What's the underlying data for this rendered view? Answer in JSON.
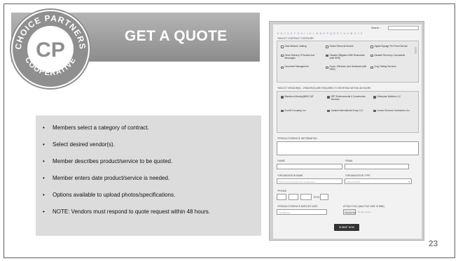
{
  "slide": {
    "title": "GET A QUOTE",
    "page_number": "23",
    "logo": {
      "text_top": "CHOICE PARTNERS",
      "monogram": "CP",
      "text_bottom": "COOPERATIVE"
    },
    "bullets": [
      "Members select a category of contract.",
      "Select desired vendor(s).",
      "Member describes product/service to be quoted.",
      "Member enters date product/service is needed.",
      "Options available to upload photos/specifications.",
      "NOTE: Vendors must respond to quote request within 48 hours."
    ]
  },
  "form": {
    "search_label": "Search :",
    "alphabet": [
      "A",
      "B",
      "C",
      "D",
      "E",
      "F",
      "G",
      "H",
      "I",
      "J",
      "K",
      "L",
      "M",
      "N",
      "O",
      "P",
      "Q",
      "R",
      "S",
      "T",
      "U",
      "V",
      "W",
      "X",
      "Y",
      "Z"
    ],
    "categories_label": "*SELECT CONTRACT CATEGORY",
    "categories": [
      {
        "label": "Data Network Cabling",
        "checked": false
      },
      {
        "label": "Debris Removal Service",
        "checked": false
      },
      {
        "label": "Digital Signage Per Fixed Service",
        "checked": false
      },
      {
        "label": "Direct Delivery Of Snacks And Beverages",
        "checked": false
      },
      {
        "label": "Disaster Mitigation With Restoration (with RMS)",
        "checked": true
      },
      {
        "label": "Disaster Recovery Consultants",
        "checked": false
      },
      {
        "label": "Document Management",
        "checked": false
      },
      {
        "label": "Doors, Windows, And Hardware (with RMS)",
        "checked": false
      },
      {
        "label": "Drug Testing Services",
        "checked": false
      }
    ],
    "vendors_label": "*SELECT VENDOR(S) - VENDOR(S) ARE REQUIRED TO RESPOND WITHIN 48 HOURS",
    "vendors": [
      {
        "label": "Blackmon Mooring/BMS CAT",
        "checked": true
      },
      {
        "label": "DRT Environmental & Construction Services",
        "checked": true
      },
      {
        "label": "Enterprise Builders LLC",
        "checked": true
      },
      {
        "label": "Ecoloft Company, Inc.",
        "checked": true
      },
      {
        "label": "Garland International Group LLC",
        "checked": true
      },
      {
        "label": "Lemon Services Contractors, Inc.",
        "checked": true
      }
    ],
    "description_label": "*PRODUCT/SERVICE INFORMATION",
    "name_label": "*NAME",
    "email_label": "*EMAIL",
    "organization_label": "*ORGANIZATION NAME",
    "organization_hint": "Harris County Department of Education",
    "org_type_label": "*ORGANIZATION TYPE",
    "org_type_value": "School District",
    "phone_label": "*PHONE",
    "ext_label": "EXT#",
    "date_label": "*PRODUCT/SERVICE NEED BY DATE",
    "date_value": "mm/dd/yyyy",
    "attach_label": "ATTACH FILE (MAX FILE SIZE IS 5MB)",
    "choose_file": "Choose File",
    "no_file": "No file chosen",
    "submit_label": "SUBMIT NOW"
  },
  "colors": {
    "header_band": "#a3a3a3",
    "bullet_box": "#dcdcdc",
    "logo": "#8f8f8f",
    "page_number": "#888888"
  }
}
